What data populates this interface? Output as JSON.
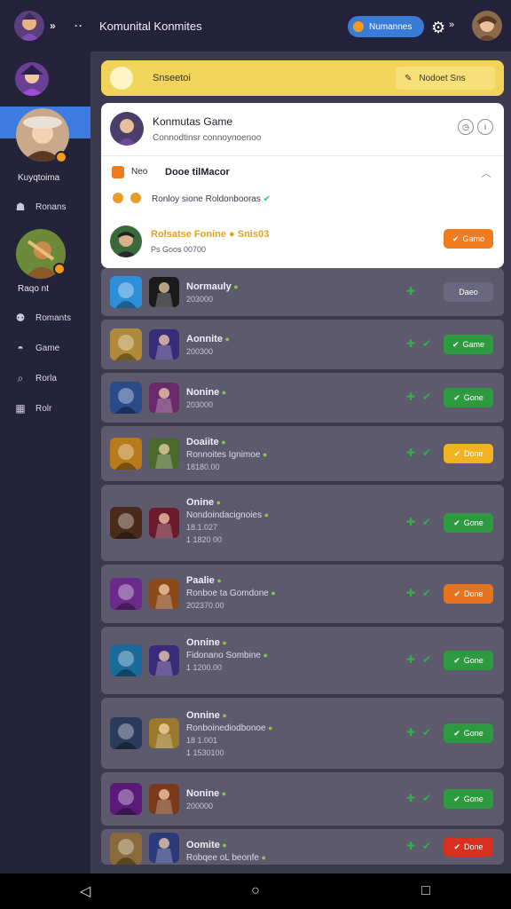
{
  "topbar": {
    "dots": "»",
    "dots2": "··",
    "title": "Komunital Konmites",
    "pill_label": "Numannes",
    "small_label": "»"
  },
  "sidebar": {
    "user1_name": "Kuyqtoima",
    "user2_name": "Raqo nt",
    "items": [
      {
        "label": "Ronans",
        "icon": "person-icon"
      },
      {
        "label": "Romants",
        "icon": "group-icon"
      },
      {
        "label": "Game",
        "icon": "game-icon"
      },
      {
        "label": "Rorla",
        "icon": "search-icon"
      },
      {
        "label": "Rolr",
        "icon": "grid-icon"
      }
    ]
  },
  "banner": {
    "text": "Snseetoi",
    "button_label": "Nodoet Sns"
  },
  "card": {
    "title": "Konmutas Game",
    "subtitle": "Connodtinsr connoynoenoo",
    "row2_left": "Neo",
    "row2_title": "Dooe tilMacor",
    "row3_text": "Ronloy sione Roldonbooras",
    "row4_title": "Rolsatse Fonine",
    "row4_tag": "Snis03",
    "row4_sub": "Ps Goos 00700",
    "button_label": "Gamo"
  },
  "list": [
    {
      "name": "Normauly",
      "desc": "",
      "code": "203000",
      "button": "Daeo",
      "color": "#6a6880"
    },
    {
      "name": "Aonnite",
      "desc": "",
      "code": "200300",
      "button": "Game",
      "color": "#2e9a3f"
    },
    {
      "name": "Nonine",
      "desc": "",
      "code": "203000",
      "button": "Gone",
      "color": "#2e9a3f"
    },
    {
      "name": "Doaiite",
      "desc": "Ronnoites Ignimoe",
      "code": "18180.00",
      "button": "Done",
      "color": "#f0b422"
    },
    {
      "name": "Onine",
      "desc": "Nondoindacignoies",
      "code": "18.1.027 | 1 1820 00",
      "button": "Gone",
      "color": "#2e9a3f"
    },
    {
      "name": "Paalie",
      "desc": "Ronboe ta Gomdone",
      "code": "202370.00",
      "button": "Done",
      "color": "#e8731e"
    },
    {
      "name": "Onnine",
      "desc": "Fidonano Sombine",
      "code": "1 1200.00",
      "button": "Gone",
      "color": "#2e9a3f"
    },
    {
      "name": "Onnine",
      "desc": "Ronboinediodbonoe",
      "code": "18 1.001 | 1 1530100",
      "button": "Gone",
      "color": "#2e9a3f"
    },
    {
      "name": "Nonine",
      "desc": "",
      "code": "200000",
      "button": "Gone",
      "color": "#2e9a3f"
    },
    {
      "name": "Oomite",
      "desc": "Robqee oL beonfe",
      "code": "",
      "button": "Done",
      "color": "#d8301e"
    }
  ]
}
